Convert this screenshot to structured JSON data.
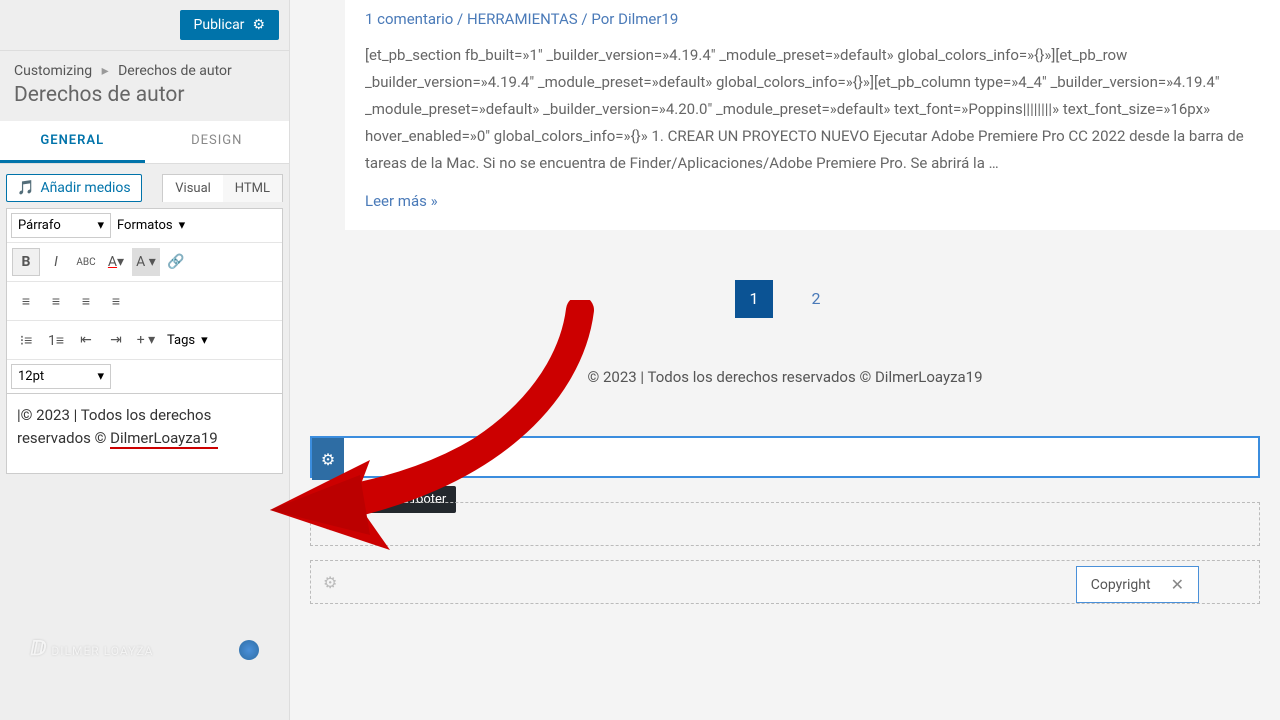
{
  "publish": {
    "label": "Publicar"
  },
  "crumb": {
    "root": "Customizing",
    "leaf": "Derechos de autor"
  },
  "page_title": "Derechos de autor",
  "tabs": {
    "general": "GENERAL",
    "design": "DESIGN"
  },
  "editor": {
    "media_btn": "Añadir medios",
    "visual": "Visual",
    "html": "HTML",
    "paragraph": "Párrafo",
    "formats": "Formatos",
    "tags": "Tags",
    "fontsize": "12pt",
    "content_pre": "|© 2023 | Todos los derechos reservados © ",
    "content_red": "DilmerLoayza19"
  },
  "post": {
    "meta_comments": "1 comentario",
    "meta_cat": "HERRAMIENTAS",
    "meta_by": "Por",
    "meta_author": "Dilmer19",
    "excerpt": "[et_pb_section fb_built=»1″ _builder_version=»4.19.4″ _module_preset=»default» global_colors_info=»{}»][et_pb_row _builder_version=»4.19.4″ _module_preset=»default» global_colors_info=»{}»][et_pb_column type=»4_4″ _builder_version=»4.19.4″ _module_preset=»default» _builder_version=»4.20.0″ _module_preset=»default» text_font=»Poppins||||||||» text_font_size=»16px» hover_enabled=»0″ global_colors_info=»{}» 1. CREAR UN PROYECTO NUEVO  Ejecutar Adobe Premiere Pro CC 2022 desde la barra de tareas de la Mac. Si no se encuentra de Finder/Aplicaciones/Adobe Premiere Pro. Se abrirá la …",
    "readmore": "Leer más »"
  },
  "pagination": {
    "p1": "1",
    "p2": "2"
  },
  "footer_copy": "© 2023 | Todos los derechos reservados © DilmerLoayza19",
  "widget": {
    "tooltip": "Above footer",
    "copyright_label": "Copyright"
  },
  "watermark": "DILMER LOAYZA"
}
